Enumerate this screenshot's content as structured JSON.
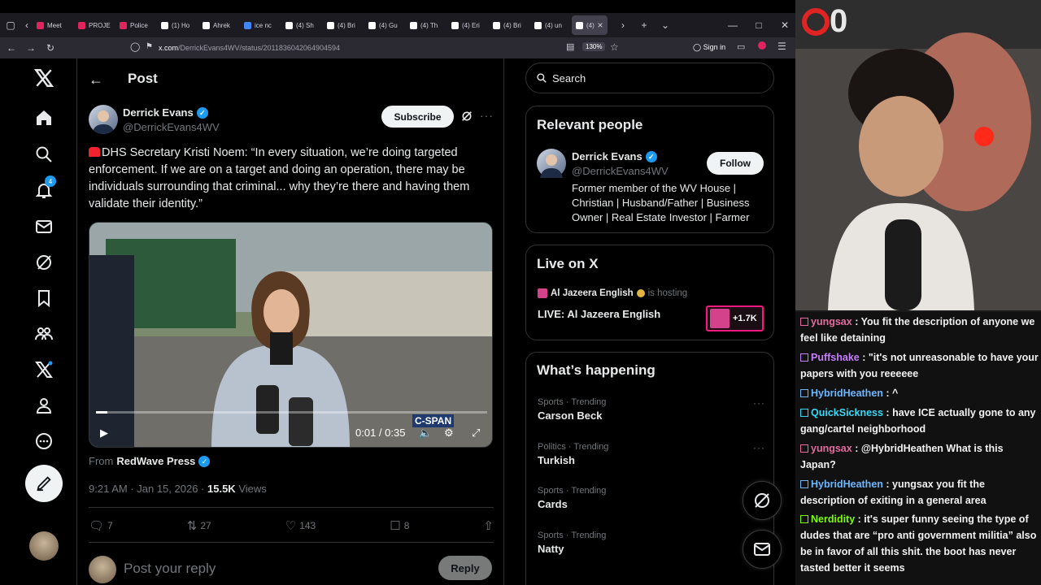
{
  "browser": {
    "tabs": [
      {
        "label": "Meet",
        "color": "#e0245e"
      },
      {
        "label": "PROJE",
        "color": "#e0245e"
      },
      {
        "label": "Police",
        "color": "#e0245e"
      },
      {
        "label": "(1) Ho",
        "color": "#ffffff"
      },
      {
        "label": "Ahrek",
        "color": "#ffffff"
      },
      {
        "label": "ice nc",
        "color": "#4285f4"
      },
      {
        "label": "(4) Sh",
        "color": "#ffffff"
      },
      {
        "label": "(4) Bri",
        "color": "#ffffff"
      },
      {
        "label": "(4) Gu",
        "color": "#ffffff"
      },
      {
        "label": "(4) Th",
        "color": "#ffffff"
      },
      {
        "label": "(4) Eri",
        "color": "#ffffff"
      },
      {
        "label": "(4) Bri",
        "color": "#ffffff"
      },
      {
        "label": "(4) un",
        "color": "#ffffff"
      },
      {
        "label": "(4)",
        "color": "#ffffff"
      }
    ],
    "url_host": "x.com",
    "url_path": "/DerrickEvans4WV/status/2011836042064904594",
    "zoom": "130%",
    "sign_in": "Sign in"
  },
  "nav": {
    "notifications_badge": "4"
  },
  "post": {
    "header_title": "Post",
    "author_name": "Derrick Evans",
    "author_handle": "@DerrickEvans4WV",
    "subscribe_label": "Subscribe",
    "text": "DHS Secretary Kristi Noem: “In every situation, we’re doing targeted enforcement. If we are on a target and doing an operation, there may be individuals surrounding that criminal... why they’re there and having them validate their identity.”",
    "video_time": "0:01 / 0:35",
    "video_progress": 0.03,
    "video_watermark": "C-SPAN",
    "from_label": "From",
    "from_source": "RedWave Press",
    "timestamp": "9:21 AM · Jan 15, 2026 ·",
    "views_count": "15.5K",
    "views_label": "Views",
    "replies": "7",
    "reposts": "27",
    "likes": "143",
    "bookmarks": "8",
    "reply_placeholder": "Post your reply",
    "reply_button": "Reply"
  },
  "sidebar": {
    "search_placeholder": "Search",
    "relevant_title": "Relevant people",
    "person_name": "Derrick Evans",
    "person_handle": "@DerrickEvans4WV",
    "follow_label": "Follow",
    "person_bio": "Former member of the WV House | Christian | Husband/Father | Business Owner | Real Estate Investor | Farmer",
    "live_title": "Live on X",
    "live_host": "Al Jazeera English",
    "live_host_suffix": "is hosting",
    "live_stream_title": "LIVE: Al Jazeera English",
    "live_count": "+1.7K",
    "happening_title": "What’s happening",
    "trends": [
      {
        "category": "Sports · Trending",
        "name": "Carson Beck"
      },
      {
        "category": "Politics · Trending",
        "name": "Turkish"
      },
      {
        "category": "Sports · Trending",
        "name": "Cards"
      },
      {
        "category": "Sports · Trending",
        "name": "Natty"
      }
    ]
  },
  "stream": {
    "overlay_number": "0",
    "chat": [
      {
        "user": "yungsax",
        "color": "#e66aa0",
        "text": "You fit the description of anyone we feel like detaining"
      },
      {
        "user": "Puffshake",
        "color": "#c77dff",
        "text": "\"it's not unreasonable to have your papers with you reeeeee"
      },
      {
        "user": "HybridHeathen",
        "color": "#6eb6ff",
        "text": "^"
      },
      {
        "user": "QuickSickness",
        "color": "#38d9f5",
        "text": "have ICE actually gone to any gang/cartel neighborhood"
      },
      {
        "user": "yungsax",
        "color": "#e66aa0",
        "text": "@HybridHeathen What is this Japan?"
      },
      {
        "user": "HybridHeathen",
        "color": "#6eb6ff",
        "text": "yungsax you fit the description of exiting in a general area"
      },
      {
        "user": "Nerdidity",
        "color": "#7cfc00",
        "text": "it's super funny seeing the type of dudes that are “pro anti government militia” also be in favor of all this shit. the boot has never tasted better it seems"
      }
    ]
  }
}
